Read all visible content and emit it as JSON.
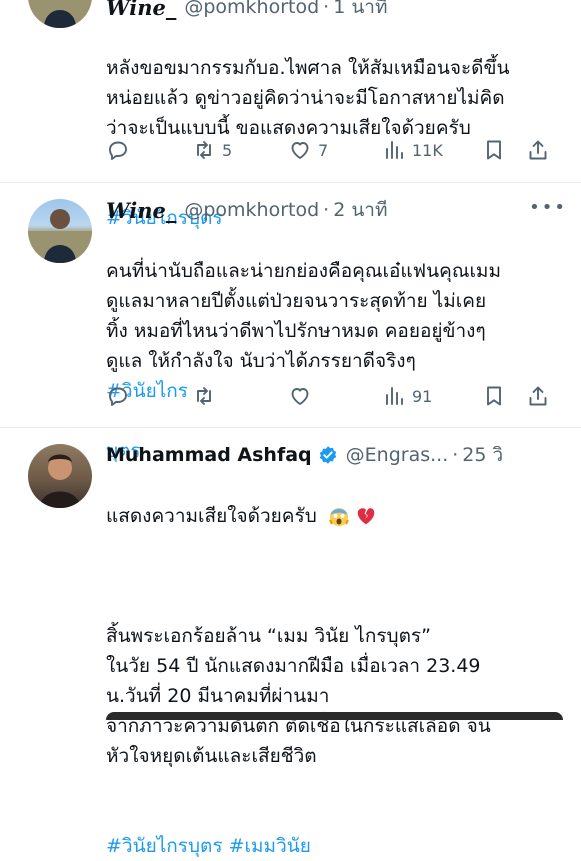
{
  "tweets": [
    {
      "header": {
        "display_name": "Wine_",
        "handle": "@pomkhortod",
        "time": "1 นาที"
      },
      "text": "หลังขอขมากรรมกับอ.ไพศาล ให้สัมเหมือนจะดีขึ้น\nหน่อยแล้ว ดูข่าวอยู่คิดว่าน่าจะมีโอกาสหายไม่คิด\nว่าจะเป็นแบบนี้ ขอแสดงความเสียใจด้วยครับ",
      "hashtags": "#วินัยไกรบุตร",
      "stats": {
        "reply": "",
        "retweet": "5",
        "like": "7",
        "views": "11K"
      }
    },
    {
      "header": {
        "display_name": "Wine_",
        "handle": "@pomkhortod",
        "time": "2 นาที"
      },
      "text": "คนที่น่านับถือและน่ายกย่องคือคุณเอ๋แฟนคุณเมม\nดูแลมาหลายปีตั้งแต่ป่วยจนวาระสุดท้าย ไม่เคย\nทิ้ง หมอที่ไหนว่าดีพาไปรักษาหมด คอยอยู่ข้างๆ\nดูแล ให้กำลังใจ นับว่าได้ภรรยาดีจริงๆ",
      "hashtag_inline_1": "#วินัยไกร",
      "hashtag_inline_2": "บุตร",
      "stats": {
        "reply": "",
        "retweet": "",
        "like": "",
        "views": "91"
      }
    },
    {
      "header": {
        "display_name": "Muhammad Ashfaq",
        "handle": "@Engras...",
        "time": "25 วิ"
      },
      "line1": "แสดงความเสียใจด้วยครับ",
      "body": "สิ้นพระเอกร้อยล้าน “เมม วินัย ไกรบุตร”\nในวัย 54 ปี นักแสดงมากฝีมือ เมื่อเวลา 23.49\nน.วันที่ 20 มีนาคมที่ผ่านมา\nจากภาวะความดันตก ติดเชื้อในกระแสเลือด จน\nหัวใจหยุดเต้นและเสียชีวิต",
      "hashtags": "#วินัยไกรบุตร #เมมวินัย"
    }
  ],
  "icons": {
    "reply": "reply-icon",
    "retweet": "retweet-icon",
    "like": "heart-icon",
    "views": "views-icon",
    "bookmark": "bookmark-icon",
    "share": "share-icon",
    "more": "more-icon",
    "verified": "verified-badge-icon"
  },
  "colors": {
    "link": "#1d9bf0",
    "secondary": "#536471",
    "text": "#0f1419",
    "divider": "#e6ebee"
  }
}
